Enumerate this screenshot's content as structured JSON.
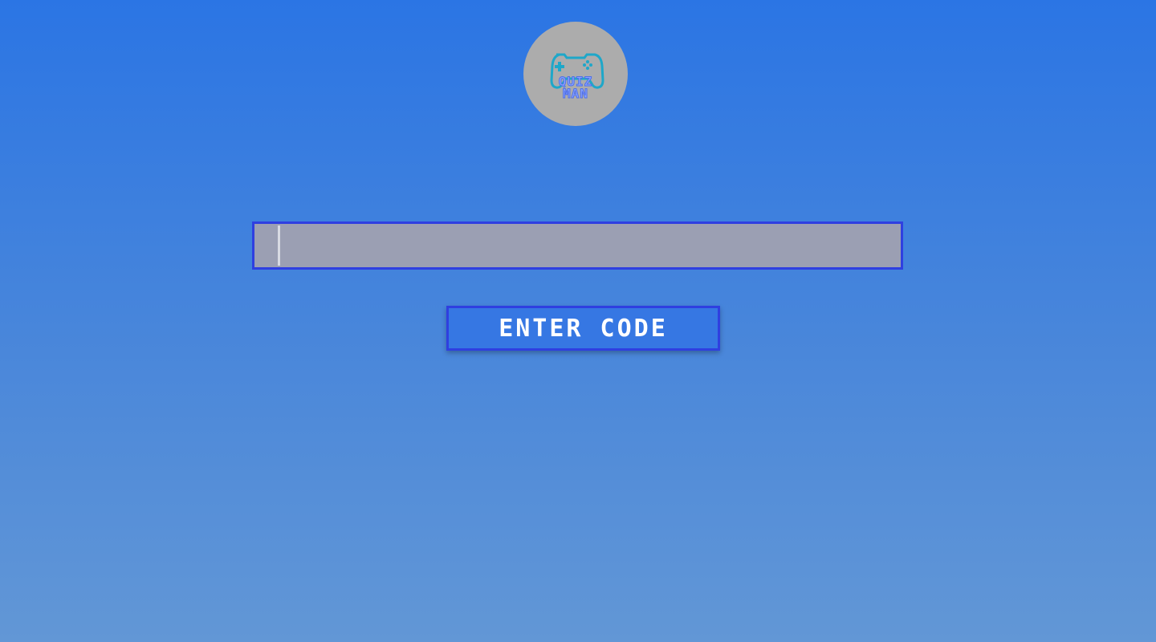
{
  "logo": {
    "icon": "gamepad-icon",
    "line1": "QUIZ",
    "line2": "MAN",
    "circle_color": "#acacac",
    "gamepad_color": "#1ea7c9",
    "text_color": "#6f8df5"
  },
  "code_input": {
    "value": "",
    "placeholder": "",
    "border_color": "#2f3fe0",
    "fill_color": "#9b9fb3"
  },
  "enter_button": {
    "label": "ENTER CODE",
    "border_color": "#2f3fe0",
    "fill_color": "#3677e3"
  },
  "colors": {
    "background_top": "#2b75e4",
    "background_bottom": "#6297d6"
  }
}
